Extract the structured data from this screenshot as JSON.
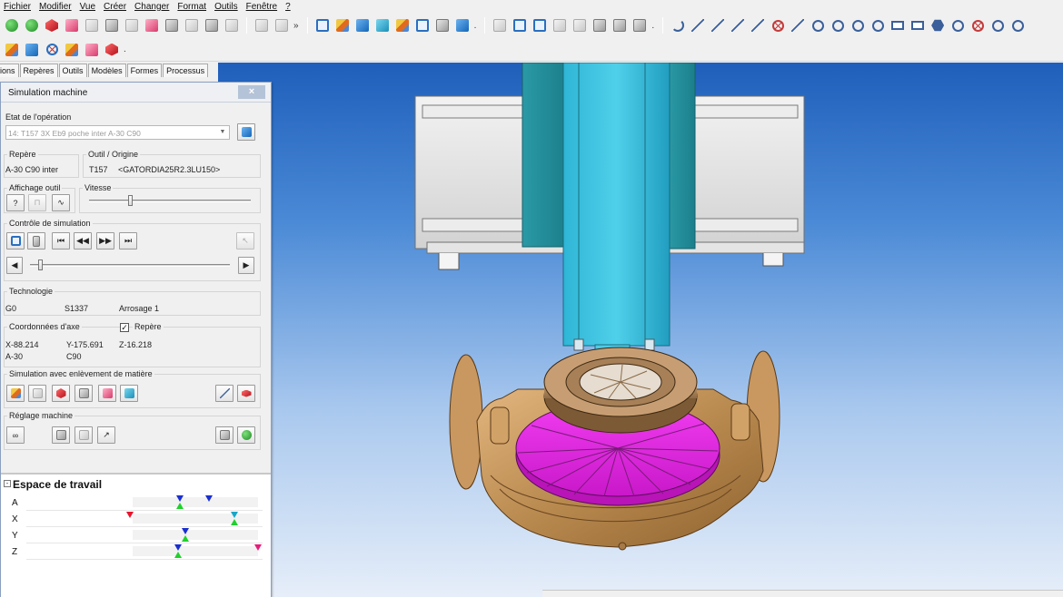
{
  "menubar": {
    "items": [
      "Fichier",
      "Modifier",
      "Vue",
      "Créer",
      "Changer",
      "Format",
      "Outils",
      "Fenêtre",
      "?"
    ]
  },
  "toolbar": {
    "more_symbol": "»",
    "dot_symbol": ".",
    "row1_groups": [
      [
        "green-sphere-icon",
        "red-shape-icon",
        "red-gear-icon",
        "frame-icon",
        "dashed-gear-icon",
        "surface-icon",
        "pink-part-icon",
        "erase-icon",
        "cursor-icon"
      ],
      [
        "layout-icon",
        "house-icon",
        "column-icon",
        "arrow-up-icon",
        "tools-icon",
        "grid-icon",
        "pen-icon",
        "question-icon"
      ],
      [
        "select-box-icon",
        "window-icon",
        "window-icon",
        "window-icon",
        "window-icon",
        "camera-icon",
        "camera-icon",
        "zoom-icon"
      ],
      [
        "curve-icon",
        "line-icon",
        "line-icon",
        "line-icon",
        "line-icon",
        "crosshair-icon",
        "angle-line-icon",
        "circle-icon",
        "circle-icon",
        "circle-icon",
        "circle-icon",
        "rectangle-icon",
        "rectangle-icon",
        "hexagon-icon",
        "hexagon-icon",
        "circle-x-icon",
        "arc-icon",
        "arc-icon"
      ]
    ],
    "row2_icons": [
      "cube-icon",
      "cube-icon",
      "cross-icon",
      "color-cube-icon",
      "red-cube-icon",
      "red-cube-icon"
    ]
  },
  "tabs": [
    "ions",
    "Repères",
    "Outils",
    "Modèles",
    "Formes",
    "Processus"
  ],
  "panel": {
    "title": "Simulation machine",
    "close_symbol": "×",
    "etat": {
      "label": "Etat de l'opération",
      "value": "14: T157 3X Eb9 poche inter A-30 C90"
    },
    "repere": {
      "label": "Repère",
      "value": "A-30 C90 inter"
    },
    "outil": {
      "label": "Outil / Origine",
      "tool": "T157",
      "desc": "<GATORDIA25R2.3LU150>"
    },
    "affichage": {
      "label": "Affichage outil"
    },
    "vitesse": {
      "label": "Vitesse",
      "level": 0.25
    },
    "controle": {
      "label": "Contrôle de simulation",
      "buttons": [
        "⏮",
        "◀◀",
        "▶▶",
        "⏭"
      ],
      "progress": 0.05,
      "scroll_left": "◀",
      "scroll_right": "▶"
    },
    "technologie": {
      "label": "Technologie",
      "g": "G0",
      "s": "S1337",
      "arrosage": "Arrosage 1"
    },
    "coordonnees": {
      "label": "Coordonnées d'axe",
      "repere_check_label": "Repère",
      "repere_checked": true,
      "check_mark": "✓",
      "x": "X-88.214",
      "y": "Y-175.691",
      "z": "Z-16.218",
      "a": "A-30",
      "c": "C90"
    },
    "enlevement": {
      "label": "Simulation avec enlèvement de matière"
    },
    "reglage": {
      "label": "Réglage machine"
    },
    "workspace": {
      "title": "Espace de travail",
      "toggle": "-",
      "axes": [
        {
          "name": "A",
          "markers": [
            {
              "type": "blue",
              "pos": 0.38
            },
            {
              "type": "green",
              "pos": 0.38
            },
            {
              "type": "blue",
              "pos": 0.61
            }
          ]
        },
        {
          "name": "X",
          "markers": [
            {
              "type": "red",
              "pos": -0.02
            },
            {
              "type": "cyan",
              "pos": 0.81
            },
            {
              "type": "green",
              "pos": 0.81
            }
          ]
        },
        {
          "name": "Y",
          "markers": [
            {
              "type": "blue",
              "pos": 0.42
            },
            {
              "type": "green",
              "pos": 0.42
            }
          ]
        },
        {
          "name": "Z",
          "markers": [
            {
              "type": "blue",
              "pos": 0.36
            },
            {
              "type": "green",
              "pos": 0.36
            },
            {
              "type": "pink",
              "pos": 1.0
            }
          ]
        }
      ]
    }
  }
}
